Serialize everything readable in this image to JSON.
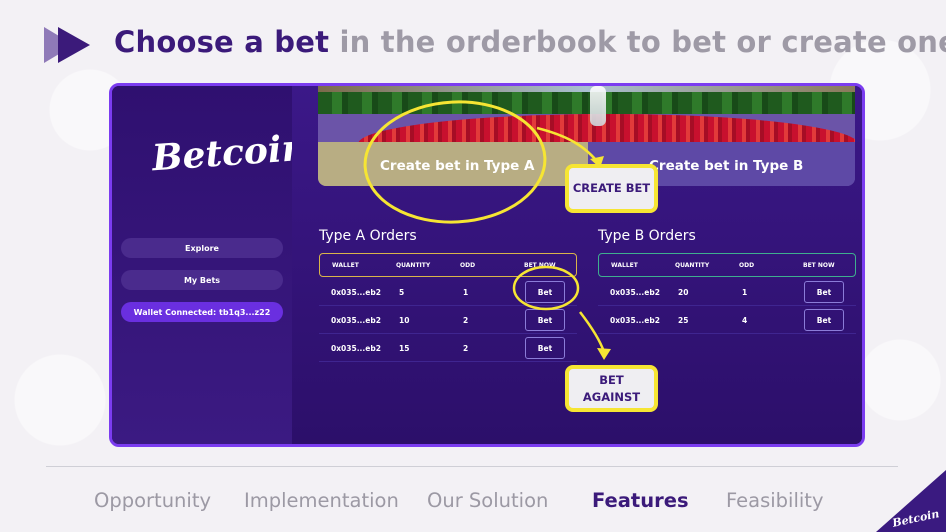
{
  "slide": {
    "headline_strong": "Choose a bet",
    "headline_rest": " in the orderbook to bet or create one"
  },
  "app": {
    "logo": "Betcoin",
    "sidebar": {
      "items": [
        {
          "label": "Explore"
        },
        {
          "label": "My Bets"
        },
        {
          "label": "Wallet Connected: tb1q3...z22"
        }
      ]
    },
    "hero": {
      "create_a": "Create bet in Type A",
      "create_b": "Create bet in Type B"
    },
    "type_a": {
      "title": "Type A Orders",
      "columns": [
        "WALLET",
        "QUANTITY",
        "ODD",
        "BET NOW"
      ],
      "rows": [
        {
          "wallet": "0x035...eb2",
          "quantity": "5",
          "odd": "1",
          "action": "Bet"
        },
        {
          "wallet": "0x035...eb2",
          "quantity": "10",
          "odd": "2",
          "action": "Bet"
        },
        {
          "wallet": "0x035...eb2",
          "quantity": "15",
          "odd": "2",
          "action": "Bet"
        }
      ]
    },
    "type_b": {
      "title": "Type B Orders",
      "columns": [
        "WALLET",
        "QUANTITY",
        "ODD",
        "BET NOW"
      ],
      "rows": [
        {
          "wallet": "0x035...eb2",
          "quantity": "20",
          "odd": "1",
          "action": "Bet"
        },
        {
          "wallet": "0x035...eb2",
          "quantity": "25",
          "odd": "4",
          "action": "Bet"
        }
      ]
    }
  },
  "callouts": {
    "create_bet": "CREATE BET",
    "bet_against": "BET\nAGAINST"
  },
  "footer_nav": {
    "items": [
      "Opportunity",
      "Implementation",
      "Our Solution",
      "Features",
      "Feasibility"
    ],
    "active": "Features"
  },
  "corner_logo": "Betcoin",
  "colors": {
    "brand_purple": "#3b1a7a",
    "highlight_yellow": "#f6e533",
    "app_background": "#2a0f63",
    "accent_violet": "#7b3cf0"
  }
}
